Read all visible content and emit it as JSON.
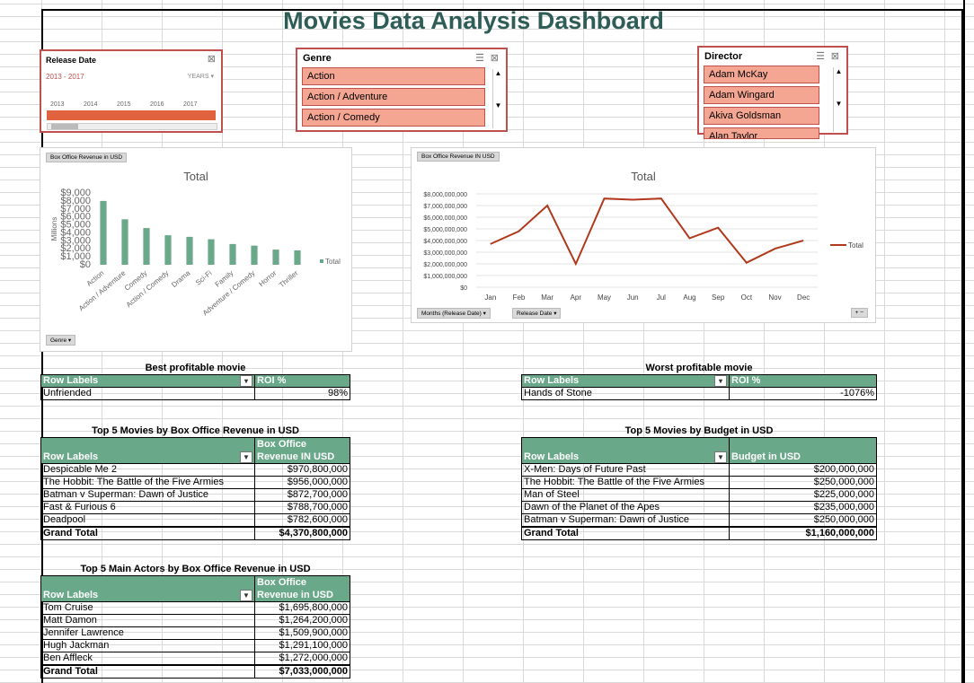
{
  "title": "Movies Data Analysis Dashboard",
  "release_slicer": {
    "header": "Release Date",
    "range": "2013 - 2017",
    "unit": "YEARS",
    "years": [
      "2013",
      "2014",
      "2015",
      "2016",
      "2017"
    ]
  },
  "genre_slicer": {
    "header": "Genre",
    "items": [
      "Action",
      "Action / Adventure",
      "Action / Comedy"
    ]
  },
  "director_slicer": {
    "header": "Director",
    "items": [
      "Adam McKay",
      "Adam Wingard",
      "Akiva Goldsman",
      "Alan Taylor"
    ]
  },
  "bar_chart_ui": {
    "field_button": "Box Office Revenue in USD",
    "filter_button": "Genre"
  },
  "line_chart_ui": {
    "field_button": "Box Office Revenue IN USD",
    "months_button": "Months (Release Date)",
    "date_button": "Release Date"
  },
  "chart_data": [
    {
      "type": "bar",
      "title": "Total",
      "ylabel": "Millions",
      "categories": [
        "Action",
        "Action / Adventure",
        "Comedy",
        "Action / Comedy",
        "Drama",
        "Sci-Fi",
        "Family",
        "Adventure / Comedy",
        "Horror",
        "Thriller"
      ],
      "series": [
        {
          "name": "Total",
          "values": [
            8000,
            5700,
            4600,
            3700,
            3500,
            3200,
            2600,
            2400,
            1900,
            1800
          ]
        }
      ],
      "yticks": [
        "$9,000",
        "$8,000",
        "$7,000",
        "$6,000",
        "$5,000",
        "$4,000",
        "$3,000",
        "$2,000",
        "$1,000",
        "$0"
      ],
      "ylim": [
        0,
        9000
      ],
      "color": "#6aa88a",
      "legend": "right"
    },
    {
      "type": "line",
      "title": "Total",
      "categories": [
        "Jan",
        "Feb",
        "Mar",
        "Apr",
        "May",
        "Jun",
        "Jul",
        "Aug",
        "Sep",
        "Oct",
        "Nov",
        "Dec"
      ],
      "series": [
        {
          "name": "Total",
          "values": [
            3700000000,
            4800000000,
            7000000000,
            2000000000,
            7600000000,
            7500000000,
            7600000000,
            4200000000,
            5100000000,
            2100000000,
            3300000000,
            4000000000
          ]
        }
      ],
      "yticks": [
        "$8,000,000,000",
        "$7,000,000,000",
        "$6,000,000,000",
        "$5,000,000,000",
        "$4,000,000,000",
        "$3,000,000,000",
        "$2,000,000,000",
        "$1,000,000,000",
        "$0"
      ],
      "ylim": [
        0,
        8000000000
      ],
      "color": "#b03a1e",
      "legend": "right"
    }
  ],
  "best": {
    "title": "Best profitable movie",
    "col1": "Row Labels",
    "col2": "ROI %",
    "row": [
      "Unfriended",
      "98%"
    ]
  },
  "worst": {
    "title": "Worst profitable movie",
    "col1": "Row Labels",
    "col2": "ROI %",
    "row": [
      "Hands of Stone",
      "-1076%"
    ]
  },
  "top_revenue": {
    "title": "Top 5 Movies by Box Office Revenue in USD",
    "col1": "Row Labels",
    "col2a": "Box Office",
    "col2b": "Revenue IN USD",
    "rows": [
      [
        "Despicable Me 2",
        "$970,800,000"
      ],
      [
        "The Hobbit: The Battle of the Five Armies",
        "$956,000,000"
      ],
      [
        "Batman v Superman: Dawn of Justice",
        "$872,700,000"
      ],
      [
        "Fast & Furious 6",
        "$788,700,000"
      ],
      [
        "Deadpool",
        "$782,600,000"
      ]
    ],
    "total": [
      "Grand Total",
      "$4,370,800,000"
    ]
  },
  "top_budget": {
    "title": "Top 5 Movies by Budget in USD",
    "col1": "Row Labels",
    "col2": "Budget in USD",
    "rows": [
      [
        "X-Men: Days of Future Past",
        "$200,000,000"
      ],
      [
        "The Hobbit: The Battle of the Five Armies",
        "$250,000,000"
      ],
      [
        "Man of Steel",
        "$225,000,000"
      ],
      [
        "Dawn of the Planet of the Apes",
        "$235,000,000"
      ],
      [
        "Batman v Superman: Dawn of Justice",
        "$250,000,000"
      ]
    ],
    "total": [
      "Grand Total",
      "$1,160,000,000"
    ]
  },
  "top_actors": {
    "title": "Top 5 Main Actors by Box Office Revenue in USD",
    "col1": "Row Labels",
    "col2a": "Box Office",
    "col2b": "Revenue in USD",
    "rows": [
      [
        "Tom Cruise",
        "$1,695,800,000"
      ],
      [
        "Matt Damon",
        "$1,264,200,000"
      ],
      [
        "Jennifer Lawrence",
        "$1,509,900,000"
      ],
      [
        "Hugh Jackman",
        "$1,291,100,000"
      ],
      [
        "Ben Affleck",
        "$1,272,000,000"
      ]
    ],
    "total": [
      "Grand Total",
      "$7,033,000,000"
    ]
  }
}
